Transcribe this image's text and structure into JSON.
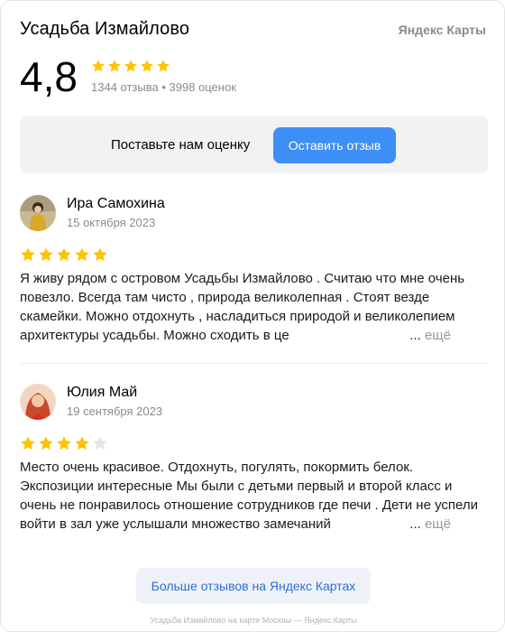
{
  "header": {
    "title": "Усадьба Измайлово",
    "brand": "Яндекс Карты"
  },
  "summary": {
    "rating": "4,8",
    "stars": 5,
    "meta": "1344 отзыва • 3998 оценок"
  },
  "cta": {
    "text": "Поставьте нам оценку",
    "button_label": "Оставить отзыв"
  },
  "reviews": [
    {
      "author": "Ира Самохина",
      "date": "15 октября 2023",
      "stars": 5,
      "text": "Я живу рядом с островом Усадьбы Измайлово . Считаю что мне очень повезло. Всегда там чисто , природа великолепная . Стоят везде скамейки. Можно отдохнуть , насладиться природой и великолепием архитектуры усадьбы. Можно сходить в це",
      "more_dots": "...",
      "more_label": "ещё"
    },
    {
      "author": "Юлия Май",
      "date": "19 сентября 2023",
      "stars": 4,
      "text": "Место очень красивое. Отдохнуть, погулять, покормить белок. Экспозиции интересные Мы были с детьми первый и второй класс и очень не понравилось отношение сотрудников где печи . Дети не успели войти в зал уже услышали множество замечаний",
      "more_dots": "...",
      "more_label": "ещё"
    }
  ],
  "more_button": "Больше отзывов на Яндекс Картах",
  "footer": "Усадьба Измайлово на карте Москвы — Яндекс.Карты",
  "colors": {
    "star_filled": "#fcc500",
    "star_empty": "#e6e6e6",
    "accent": "#3d8ef5"
  },
  "icons": {
    "star": "star-icon"
  }
}
